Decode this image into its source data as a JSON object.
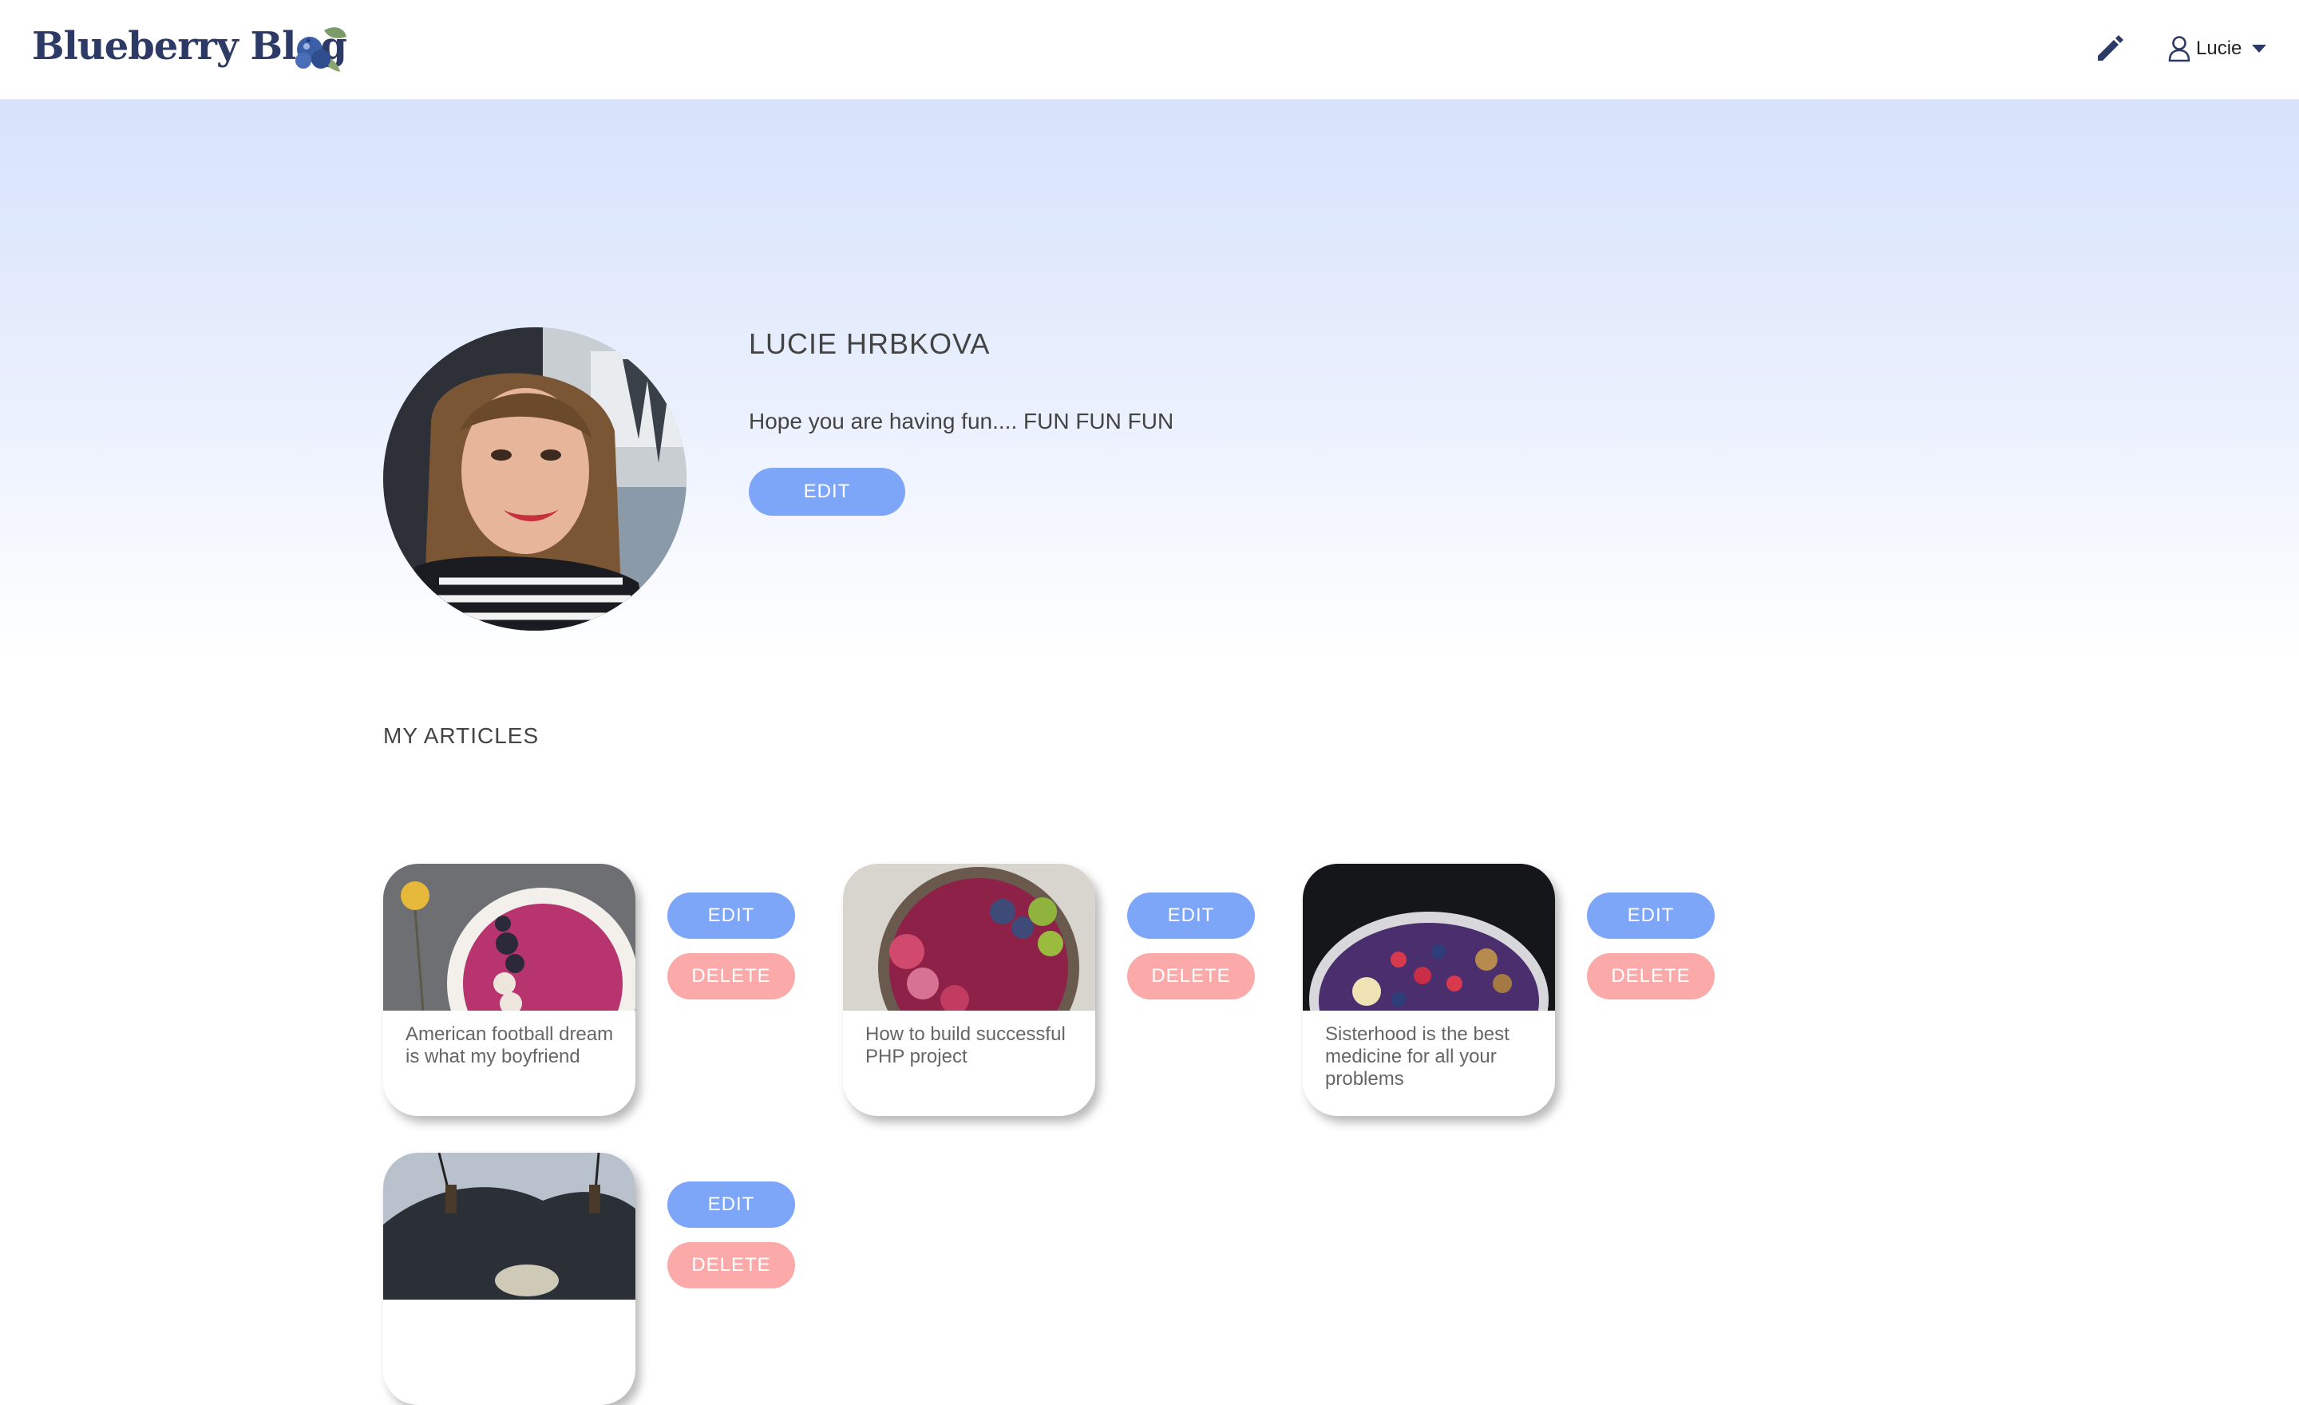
{
  "nav": {
    "logo": "Blueberry Blog",
    "logo_icon": "blueberry-icon",
    "write_icon": "pencil-icon",
    "user_icon": "user-icon",
    "user_name": "Lucie",
    "dropdown_icon": "caret-down-icon"
  },
  "profile": {
    "name": "LUCIE HRBKOVA",
    "bio": "Hope you are having fun.... FUN FUN FUN",
    "edit_label": "EDIT"
  },
  "articles_section": {
    "title": "MY ARTICLES"
  },
  "articles": [
    {
      "title": "American football dream is what my boyfriend",
      "edit_label": "EDIT",
      "delete_label": "DELETE"
    },
    {
      "title": "How to build successful PHP project",
      "edit_label": "EDIT",
      "delete_label": "DELETE"
    },
    {
      "title": "Sisterhood is the best medicine for all your problems",
      "edit_label": "EDIT",
      "delete_label": "DELETE"
    },
    {
      "title": "",
      "edit_label": "EDIT",
      "delete_label": "DELETE"
    }
  ],
  "colors": {
    "accent_blue": "#7ea6f8",
    "accent_pink": "#fba9a9",
    "logo_navy": "#2e3a66"
  }
}
